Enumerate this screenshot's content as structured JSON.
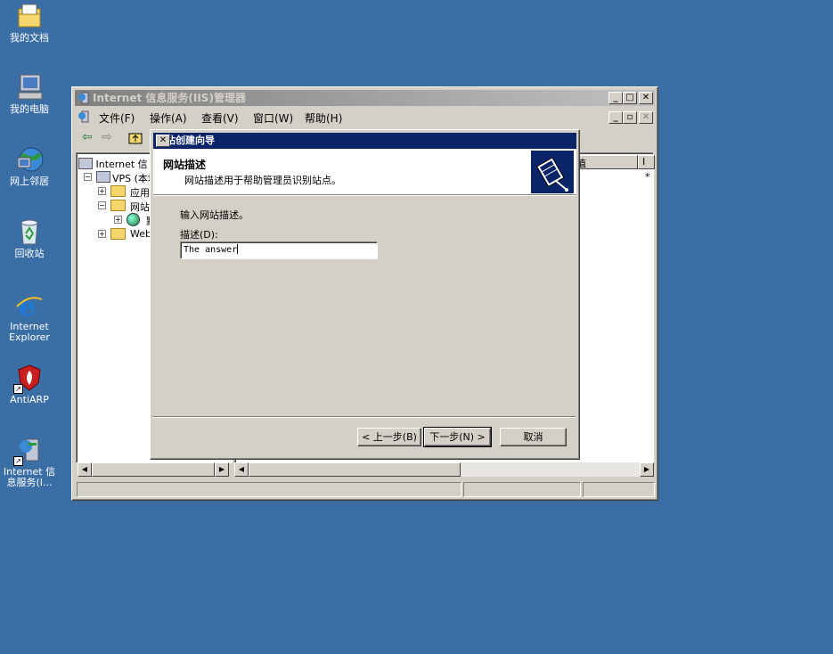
{
  "desktop": {
    "icons": [
      {
        "label": "我的文档",
        "icon": "my-documents-icon"
      },
      {
        "label": "我的电脑",
        "icon": "my-computer-icon"
      },
      {
        "label": "网上邻居",
        "icon": "network-places-icon"
      },
      {
        "label": "回收站",
        "icon": "recycle-bin-icon"
      },
      {
        "label": "Internet\nExplorer",
        "icon": "internet-explorer-icon"
      },
      {
        "label": "AntiARP",
        "icon": "antiarp-icon"
      },
      {
        "label": "Internet 信\n息服务(I...",
        "icon": "iis-shortcut-icon"
      }
    ]
  },
  "iis_window": {
    "title": "Internet 信息服务(IIS)管理器",
    "menu": [
      "文件(F)",
      "操作(A)",
      "查看(V)",
      "窗口(W)",
      "帮助(H)"
    ],
    "tree": [
      {
        "label": "Internet 信",
        "expander": ""
      },
      {
        "label": "VPS (本地",
        "expander": "−"
      },
      {
        "label": "应用",
        "expander": "+"
      },
      {
        "label": "网站",
        "expander": "−"
      },
      {
        "label": "默",
        "expander": "+"
      },
      {
        "label": "Web",
        "expander": "+"
      }
    ],
    "right_pane": {
      "col1": "值",
      "col2": "I",
      "cell": "*"
    }
  },
  "wizard": {
    "title": "网站创建向导",
    "header_title": "网站描述",
    "header_subtitle": "网站描述用于帮助管理员识别站点。",
    "instruction": "输入网站描述。",
    "field_label": "描述(D):",
    "field_value": "The answer",
    "buttons": {
      "back": "< 上一步(B)",
      "next": "下一步(N) >",
      "cancel": "取消"
    }
  },
  "colors": {
    "desktop": "#3a6ea5",
    "active_title": "#0a246a",
    "inactive_title": "#808080",
    "face": "#d4d0c8"
  }
}
